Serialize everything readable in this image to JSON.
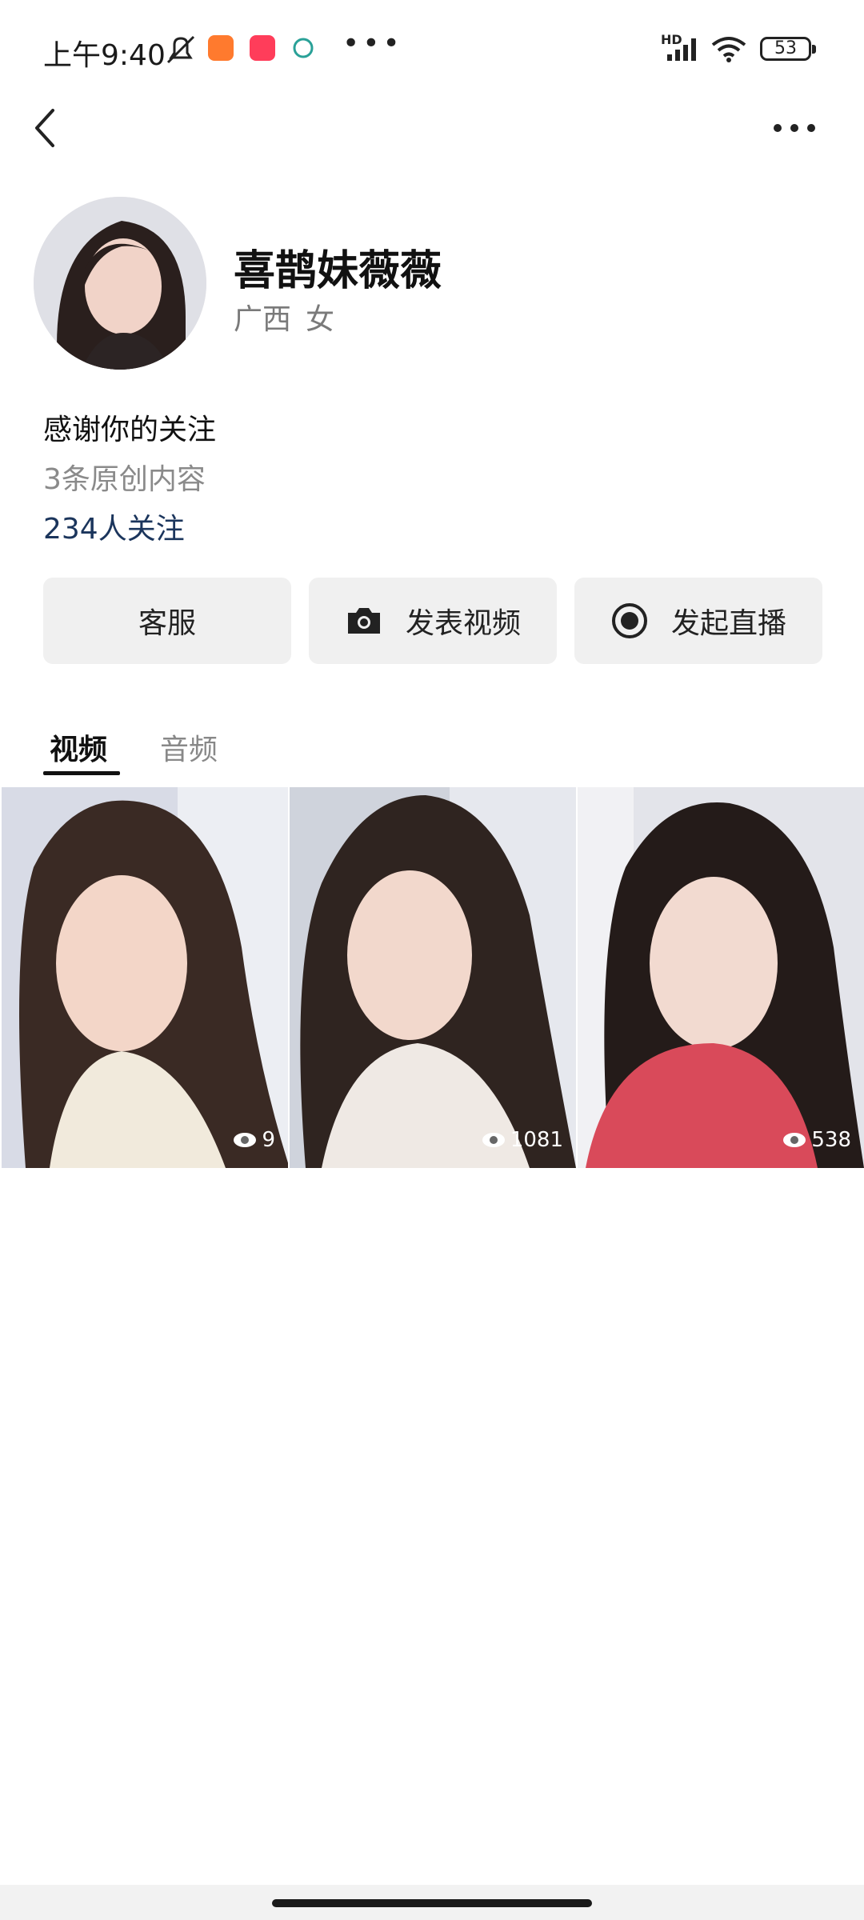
{
  "status_bar": {
    "time": "上午9:40",
    "battery": "53",
    "network": "HD"
  },
  "nav": {
    "back_icon": "chevron-left-icon",
    "more_icon": "more-horizontal-icon"
  },
  "profile": {
    "name": "喜鹊妹薇薇",
    "region": "广西",
    "gender": "女",
    "bio": "感谢你的关注",
    "original_count": "3条原创内容",
    "followers": "234人关注"
  },
  "actions": [
    {
      "label": "客服"
    },
    {
      "label": "发表视频",
      "icon": "camera-icon"
    },
    {
      "label": "发起直播",
      "icon": "live-record-icon"
    }
  ],
  "tabs": [
    {
      "label": "视频",
      "active": true
    },
    {
      "label": "音频",
      "active": false
    }
  ],
  "videos": [
    {
      "views": "9"
    },
    {
      "views": "1081"
    },
    {
      "views": "538"
    }
  ],
  "colors": {
    "link": "#1b355c",
    "button_bg": "#f0f0f0"
  }
}
